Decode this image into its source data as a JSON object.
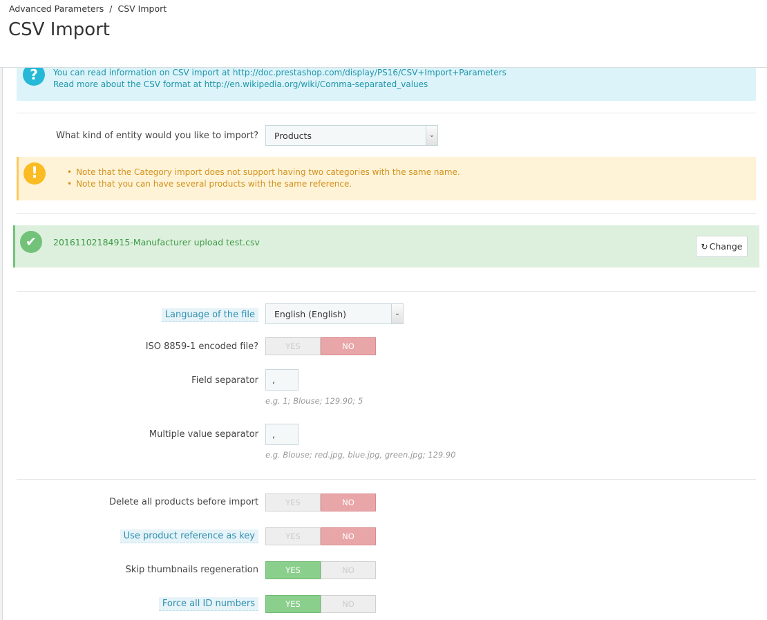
{
  "breadcrumb": {
    "parent": "Advanced Parameters",
    "separator": "/",
    "current": "CSV Import"
  },
  "page_title": "CSV Import",
  "info_alert": {
    "icon": "question-icon",
    "line1_text": "You can read information on CSV import at ",
    "line1_link": "http://doc.prestashop.com/display/PS16/CSV+Import+Parameters",
    "line2_text": "Read more about the CSV format at ",
    "line2_link": "http://en.wikipedia.org/wiki/Comma-separated_values"
  },
  "entity": {
    "label": "What kind of entity would you like to import?",
    "value": "Products"
  },
  "warning_alert": {
    "icon": "exclamation-icon",
    "items": [
      "Note that the Category import does not support having two categories with the same name.",
      "Note that you can have several products with the same reference."
    ]
  },
  "file": {
    "name": "20161102184915-Manufacturer upload test.csv",
    "change_label": "Change",
    "icon": "check-icon"
  },
  "language": {
    "label": "Language of the file",
    "value": "English (English)"
  },
  "iso": {
    "label": "ISO 8859-1 encoded file?",
    "yes": "YES",
    "no": "NO",
    "selected": "no"
  },
  "field_separator": {
    "label": "Field separator",
    "value": ",",
    "help": "e.g. 1; Blouse; 129.90; 5"
  },
  "multi_separator": {
    "label": "Multiple value separator",
    "value": ",",
    "help": "e.g. Blouse; red.jpg, blue.jpg, green.jpg; 129.90"
  },
  "delete_all": {
    "label": "Delete all products before import",
    "yes": "YES",
    "no": "NO",
    "selected": "no"
  },
  "use_reference": {
    "label": "Use product reference as key",
    "yes": "YES",
    "no": "NO",
    "selected": "no"
  },
  "skip_thumbs": {
    "label": "Skip thumbnails regeneration",
    "yes": "YES",
    "no": "NO",
    "selected": "yes"
  },
  "force_ids": {
    "label": "Force all ID numbers",
    "yes": "YES",
    "no": "NO",
    "selected": "yes"
  },
  "colors": {
    "info": "#25b9d7",
    "warning": "#fbbb22",
    "success": "#72c279",
    "no_active": "#e9a6a9",
    "yes_active": "#8bcf8d"
  }
}
